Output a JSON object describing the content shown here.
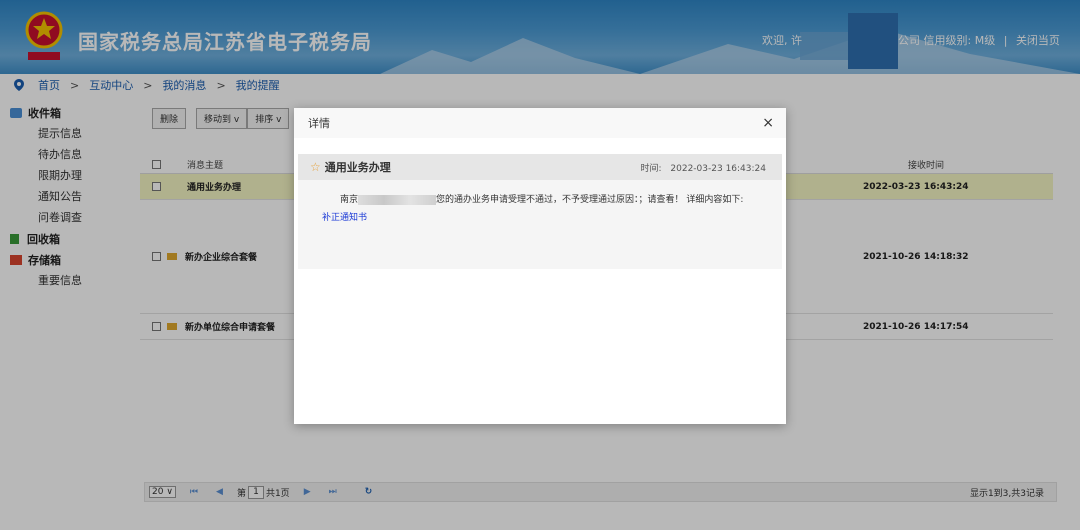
{
  "header": {
    "title": "国家税务总局江苏省电子税务局",
    "welcome": "欢迎, 许",
    "company_suffix": "公司",
    "credit_label": "信用级别:",
    "credit_level": "M级",
    "separator": "|",
    "close_page": "关闭当页",
    "emblem_icon": "tax-emblem-icon"
  },
  "breadcrumb": {
    "items": [
      "首页",
      "互动中心",
      "我的消息",
      "我的提醒"
    ],
    "sep": ">",
    "icon": "location-pin-icon"
  },
  "sidebar": {
    "inbox": "收件箱",
    "inbox_items": [
      "提示信息",
      "待办信息",
      "限期办理",
      "通知公告",
      "问卷调查"
    ],
    "recycle": "回收箱",
    "storage": "存储箱",
    "storage_items": [
      "重要信息"
    ]
  },
  "toolbar": {
    "delete": "删除",
    "move_to": "移动到 v",
    "sort": "排序 v"
  },
  "grid": {
    "col_subject": "消息主题",
    "col_time": "接收时间",
    "rows": [
      {
        "subject": "通用业务办理",
        "time": "2022-03-23 16:43:24"
      },
      {
        "subject": "新办企业综合套餐",
        "time": "2021-10-26 14:18:32"
      },
      {
        "subject": "新办单位综合申请套餐",
        "time": "2021-10-26 14:17:54"
      }
    ]
  },
  "pager": {
    "page_size": "20 ∨",
    "first": "⏮",
    "prev": "◀",
    "page_label": "第",
    "page_value": "1",
    "page_total": "共1页",
    "next": "▶",
    "last": "⏭",
    "refresh": "↻",
    "info": "显示1到3,共3记录"
  },
  "dialog": {
    "title": "详情",
    "close": "×",
    "msg_title": "通用业务办理",
    "time_label": "时间:",
    "time_value": "2022-03-23 16:43:24",
    "text_prefix": "南京",
    "text_suffix": "您的通办业务申请受理不通过，不予受理通过原因：；请查看！ 详细内容如下:",
    "link": "补正通知书"
  },
  "colors": {
    "header_blue": "#2f86c6",
    "highlight_row": "#f4f5c4",
    "link_blue": "#1a39d6"
  }
}
